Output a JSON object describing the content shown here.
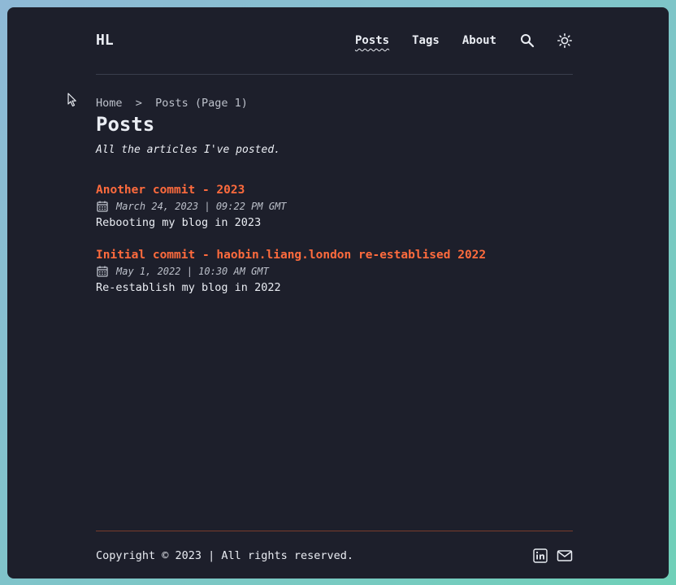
{
  "header": {
    "logo": "HL",
    "nav": [
      {
        "label": "Posts",
        "active": true
      },
      {
        "label": "Tags",
        "active": false
      },
      {
        "label": "About",
        "active": false
      }
    ],
    "search_icon": "search-icon",
    "theme_icon": "sun-icon"
  },
  "breadcrumb": {
    "home": "Home",
    "separator": ">",
    "current": "Posts (Page 1)"
  },
  "page": {
    "title": "Posts",
    "description": "All the articles I've posted."
  },
  "posts": [
    {
      "title": "Another commit - 2023",
      "date": "March 24, 2023 | 09:22 PM GMT",
      "description": "Rebooting my blog in 2023"
    },
    {
      "title": "Initial commit - haobin.liang.london re-establised 2022",
      "date": "May 1, 2022 | 10:30 AM GMT",
      "description": "Re-establish my blog in 2022"
    }
  ],
  "footer": {
    "copyright": "Copyright © 2023 | All rights reserved.",
    "social": [
      "linkedin-icon",
      "mail-icon"
    ]
  },
  "colors": {
    "background": "#1d1f2b",
    "accent": "#ff6b3d",
    "text": "#eaedf3",
    "muted": "#bcc0ca"
  }
}
